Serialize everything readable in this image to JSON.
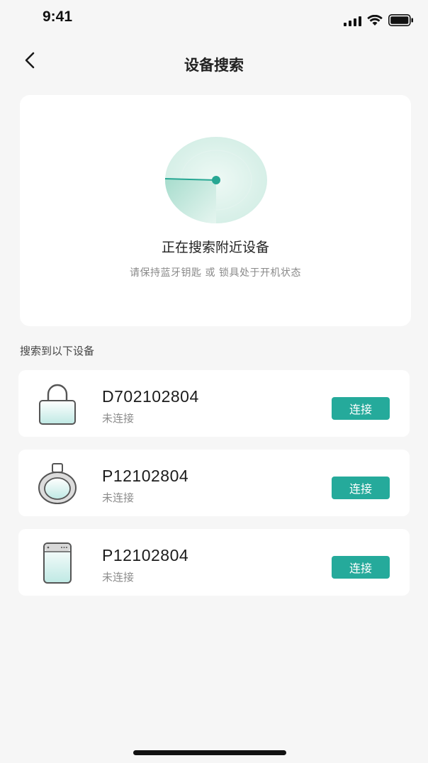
{
  "status_bar": {
    "time": "9:41",
    "icons": [
      "signal-icon",
      "wifi-icon",
      "battery-icon"
    ]
  },
  "nav": {
    "back_icon": "chevron-left-icon",
    "title": "设备搜索"
  },
  "search": {
    "title": "正在搜索附近设备",
    "hint": "请保持蓝牙钥匙 或 锁具处于开机状态"
  },
  "results_label": "搜索到以下设备",
  "devices": [
    {
      "icon": "padlock-icon",
      "name": "D702102804",
      "status": "未连接",
      "action": "连接"
    },
    {
      "icon": "ring-lock-icon",
      "name": "P12102804",
      "status": "未连接",
      "action": "连接"
    },
    {
      "icon": "key-fob-icon",
      "name": "P12102804",
      "status": "未连接",
      "action": "连接"
    }
  ],
  "colors": {
    "accent": "#25aa9b",
    "background": "#f6f6f6",
    "card": "#ffffff",
    "radar": "#d9f1ea"
  }
}
